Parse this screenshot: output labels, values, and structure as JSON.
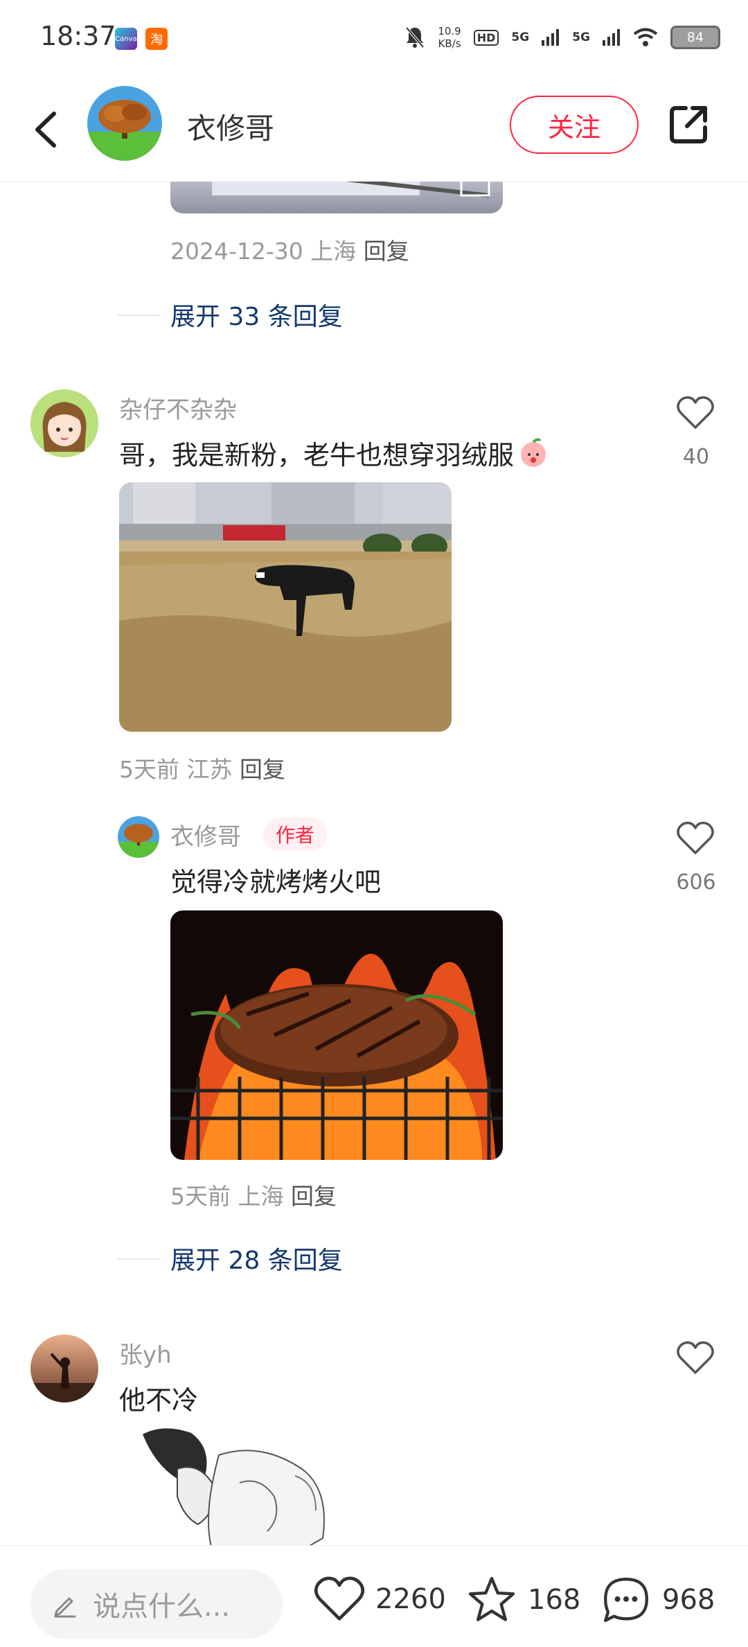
{
  "status_bar": {
    "time": "18:37",
    "app_badges": [
      "Canva",
      "淘"
    ],
    "net_speed_value": "10.9",
    "net_speed_unit": "KB/s",
    "hd_label": "HD",
    "sim1": "5G",
    "sim2": "5G",
    "battery": "84"
  },
  "header": {
    "user_name": "衣修哥",
    "follow_label": "关注"
  },
  "thread1": {
    "meta_date": "2024-12-30",
    "meta_location": "上海",
    "reply_label": "回复",
    "expand_label": "展开 33 条回复"
  },
  "comment1": {
    "user": "杂仔不杂杂",
    "text": "哥，我是新粉，老牛也想穿羽绒服",
    "likes": "40",
    "time": "5天前",
    "location": "江苏",
    "reply_label": "回复"
  },
  "reply1": {
    "user": "衣修哥",
    "tag": "作者",
    "text": "觉得冷就烤烤火吧",
    "likes": "606",
    "time": "5天前",
    "location": "上海",
    "reply_label": "回复",
    "expand_label": "展开 28 条回复"
  },
  "comment2": {
    "user": "张yh",
    "text": "他不冷"
  },
  "bottom_bar": {
    "input_placeholder": "说点什么...",
    "likes": "2260",
    "favorites": "168",
    "comments": "968"
  },
  "colors": {
    "accent": "#ff2442",
    "link": "#13386c"
  }
}
